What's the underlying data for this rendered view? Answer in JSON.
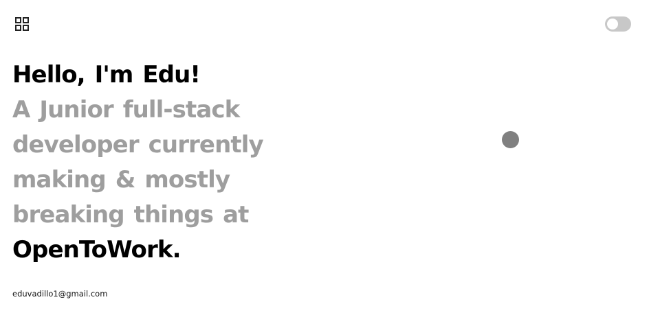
{
  "header": {
    "menu_icon": "grid-icon",
    "theme_toggle": {
      "state": "off",
      "icon": "toggle-switch"
    }
  },
  "hero": {
    "greeting": "Hello, I'm Edu!",
    "tagline_lines": [
      "A Junior full-stack",
      "developer currently",
      "making & mostly",
      "breaking things at"
    ],
    "company": "OpenToWork."
  },
  "footer": {
    "email": "eduvadillo1@gmail.com"
  },
  "colors": {
    "primary_text": "#000000",
    "muted_text": "#9e9e9e",
    "toggle_track": "#c8c8c8",
    "cursor_dot": "#808080",
    "background": "#ffffff"
  }
}
